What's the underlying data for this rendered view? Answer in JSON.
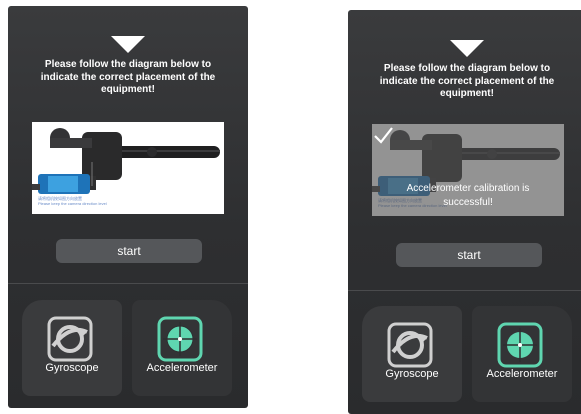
{
  "screens": [
    {
      "instruction": "Please follow the diagram below to indicate the correct placement of the equipment!",
      "photo_caption_line1": "请将相机按如图方向放置",
      "photo_caption_line2": "Please keep the camera direction level",
      "start_label": "start",
      "tabs": {
        "left": "Gyroscope",
        "right": "Accelerometer"
      },
      "overlay": null
    },
    {
      "instruction": "Please follow the diagram below to indicate the correct placement of the equipment!",
      "photo_caption_line1": "请将相机按如图方向放置",
      "photo_caption_line2": "Please keep the camera direction level",
      "start_label": "start",
      "tabs": {
        "left": "Gyroscope",
        "right": "Accelerometer"
      },
      "overlay": {
        "message": "Accelerometer calibration is successful!"
      }
    }
  ],
  "colors": {
    "accent": "#5fd6b0",
    "background": "#333436"
  },
  "icons": {
    "arrow": "down-triangle-icon",
    "gyroscope": "gyroscope-icon",
    "accelerometer": "crosshair-icon",
    "check": "checkmark-icon"
  }
}
